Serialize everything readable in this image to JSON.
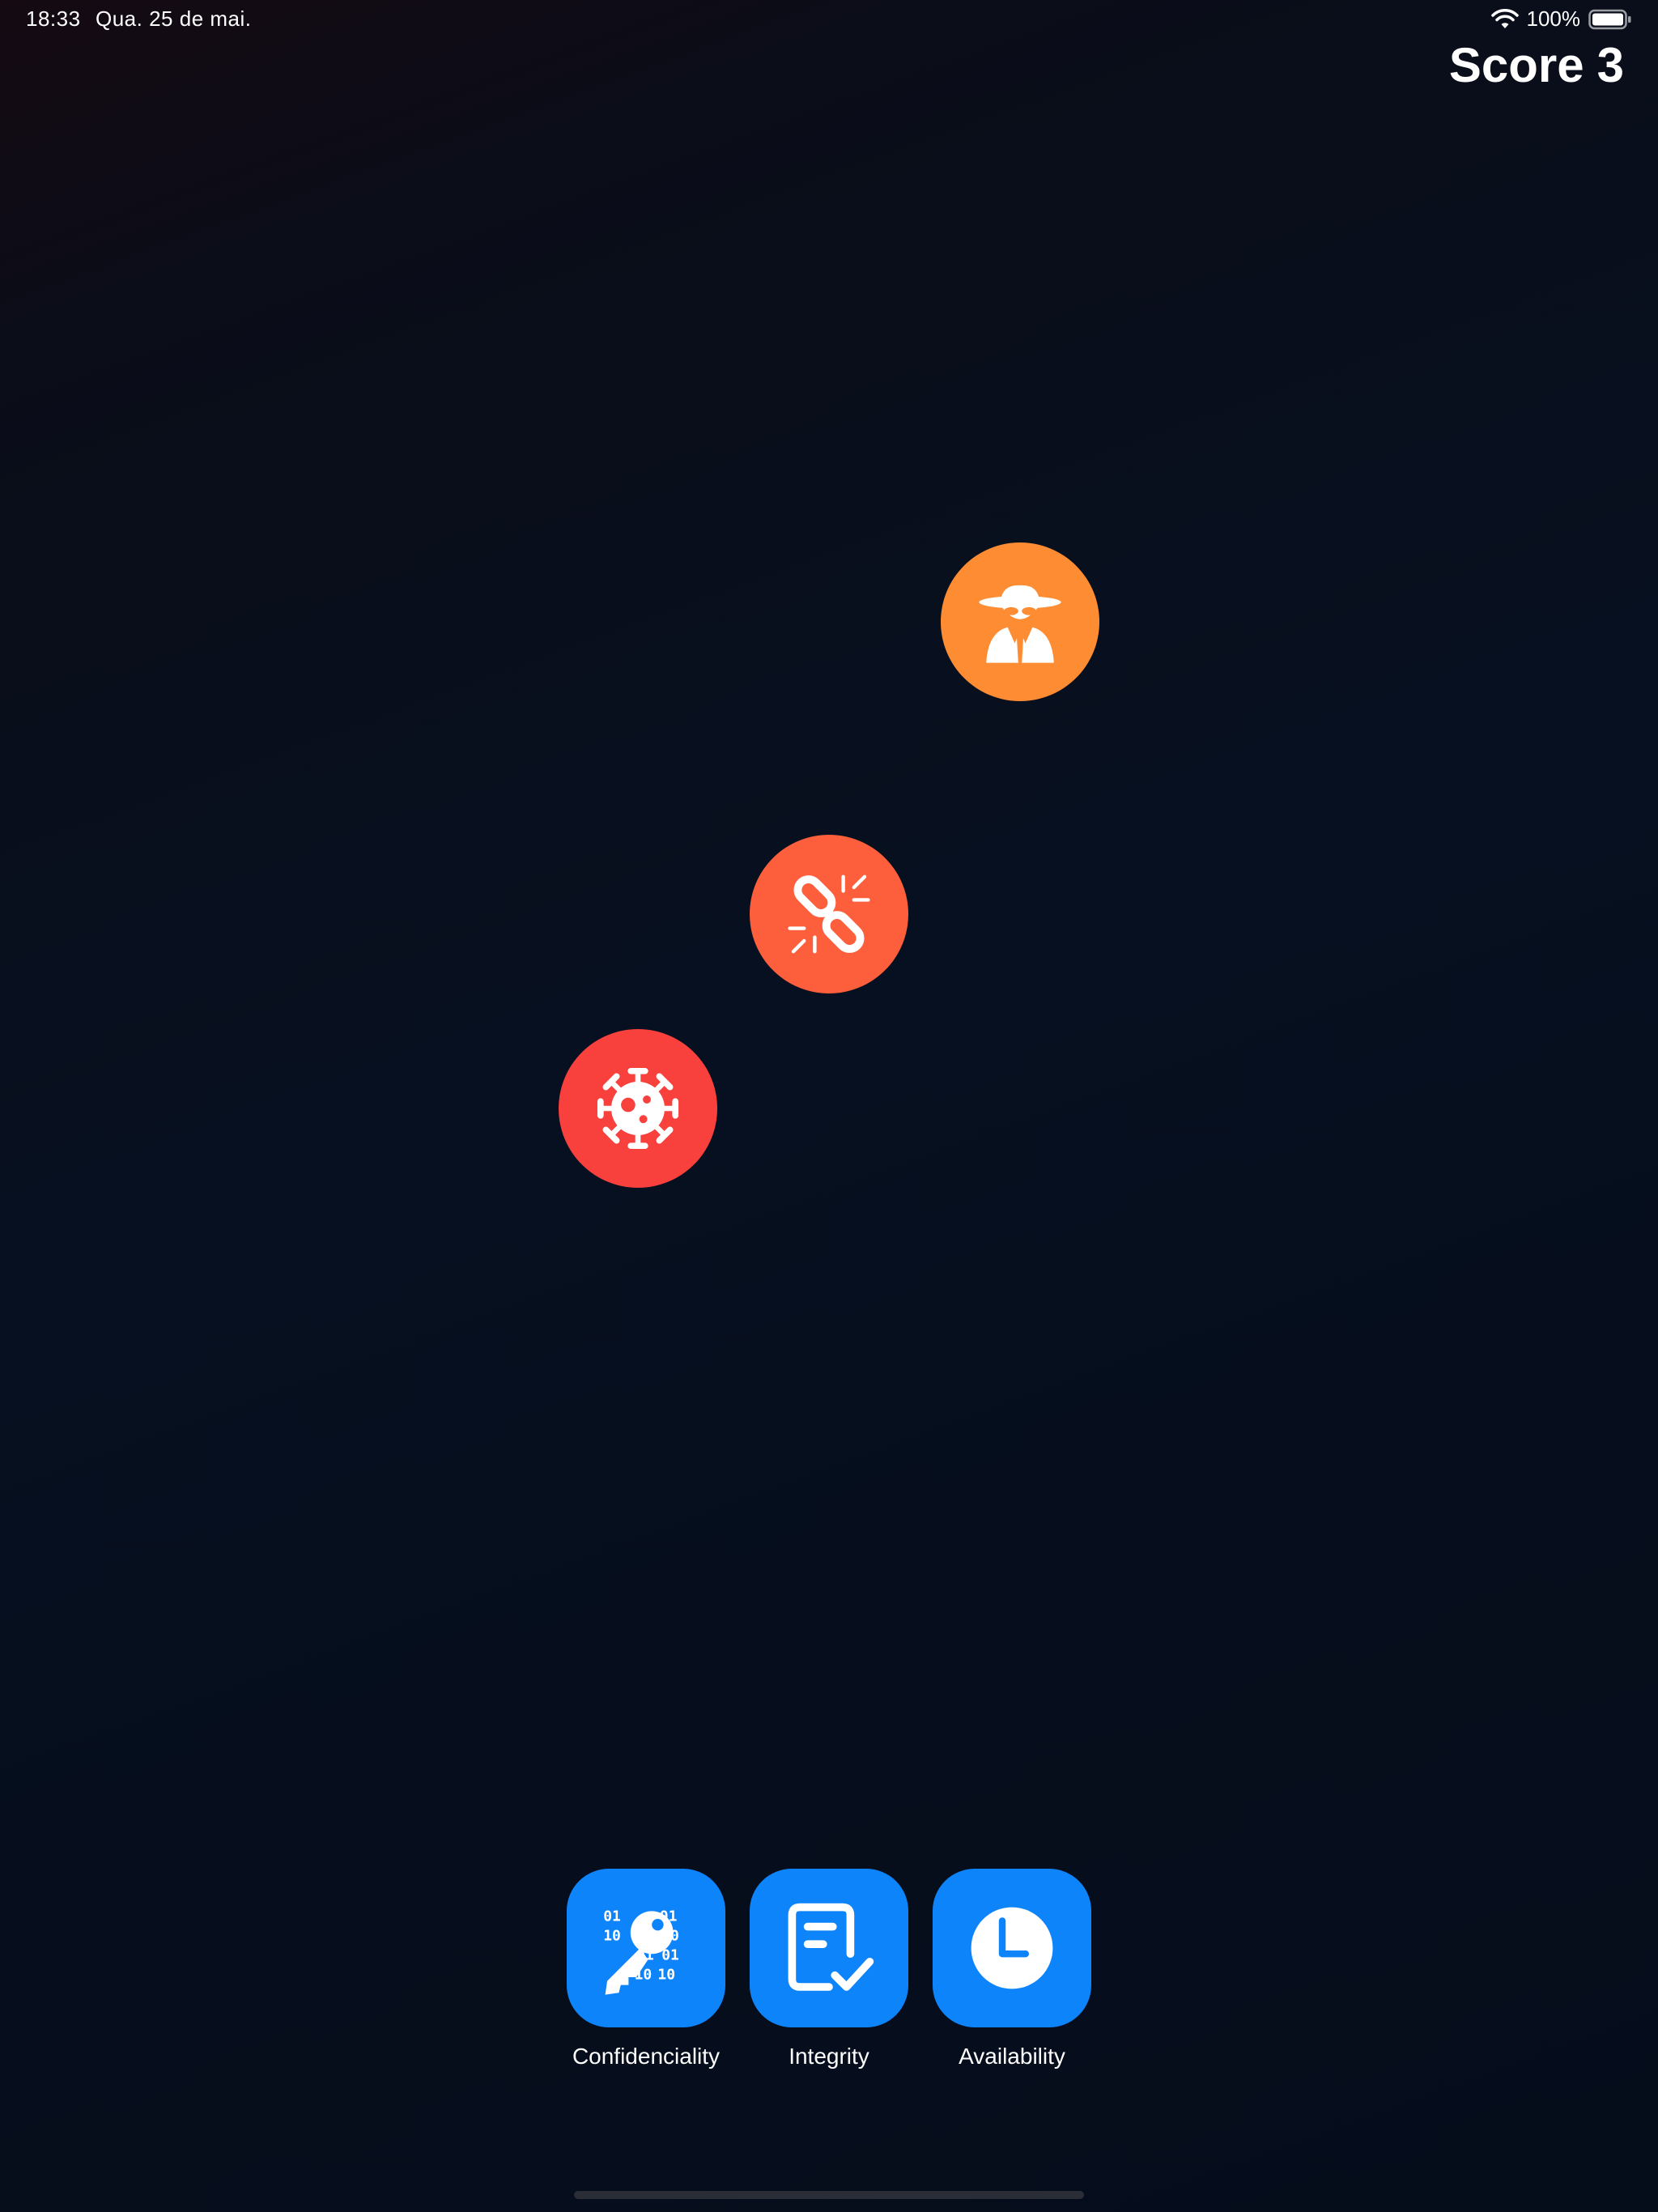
{
  "status_bar": {
    "time": "18:33",
    "date": "Qua. 25 de mai.",
    "battery": "100%",
    "wifi_icon": "wifi-icon",
    "battery_icon": "battery-full-icon"
  },
  "score": {
    "label": "Score",
    "value": "3"
  },
  "threats": [
    {
      "name": "spy",
      "icon": "spy-incognito-icon",
      "color": "#fd8c33"
    },
    {
      "name": "broken-link",
      "icon": "broken-link-icon",
      "color": "#fd5e3c"
    },
    {
      "name": "virus",
      "icon": "virus-icon",
      "color": "#f8403d"
    }
  ],
  "actions": [
    {
      "label": "Confidenciality",
      "icon": "binary-key-icon",
      "color": "#0e84fb"
    },
    {
      "label": "Integrity",
      "icon": "document-check-icon",
      "color": "#0e84fb"
    },
    {
      "label": "Availability",
      "icon": "clock-icon",
      "color": "#0e84fb"
    }
  ],
  "colors": {
    "background": "#060d1b",
    "action_blue": "#0e84fb",
    "text": "#ffffff"
  }
}
